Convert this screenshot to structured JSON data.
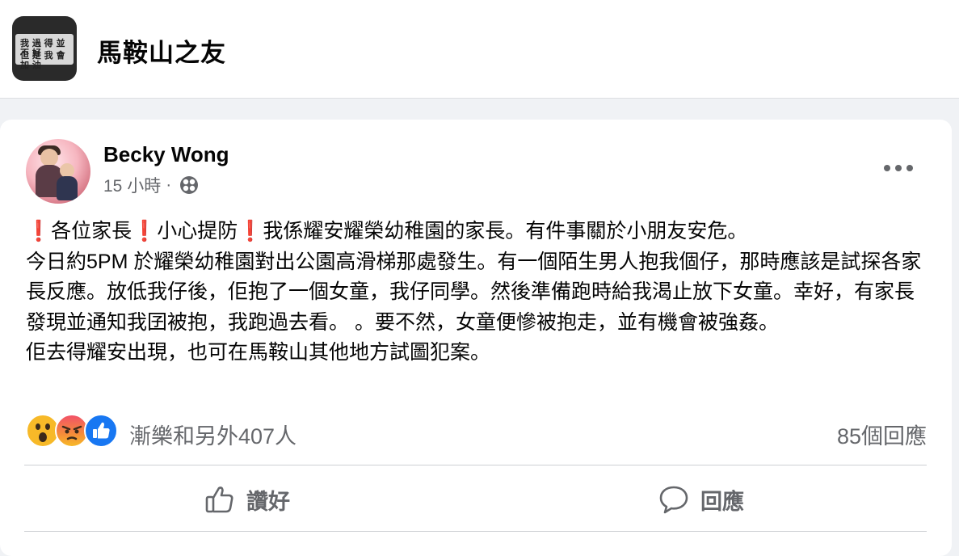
{
  "group": {
    "name": "馬鞍山之友",
    "cover_text_line1": "我 過 得 並 不 好",
    "cover_text_line2": "但 是 我 會 加 油"
  },
  "post": {
    "author": "Becky Wong",
    "time": "15 小時",
    "separator": "·",
    "privacy_icon": "public-globe-icon",
    "body": "❗各位家長❗小心提防❗我係耀安耀榮幼稚園的家長。有件事關於小朋友安危。\n今日約5PM 於耀榮幼稚園對出公園高滑梯那處發生。有一個陌生男人抱我個仔，那時應該是試探各家長反應。放低我仔後，佢抱了一個女童，我仔同學。然後準備跑時給我渴止放下女童。幸好，有家長發現並通知我囝被抱，我跑過去看。 。要不然，女童便慘被抱走，並有機會被強姦。\n佢去得耀安出現，也可在馬鞍山其他地方試圖犯案。"
  },
  "reactions": {
    "icons": [
      "wow-reaction-icon",
      "angry-reaction-icon",
      "like-reaction-icon"
    ],
    "summary": "漸樂和另外407人",
    "comments": "85個回應"
  },
  "actions": {
    "like_label": "讚好",
    "comment_label": "回應"
  },
  "colors": {
    "background": "#f0f2f5",
    "card": "#ffffff",
    "secondary_text": "#65676b",
    "like_blue": "#1877f2"
  }
}
